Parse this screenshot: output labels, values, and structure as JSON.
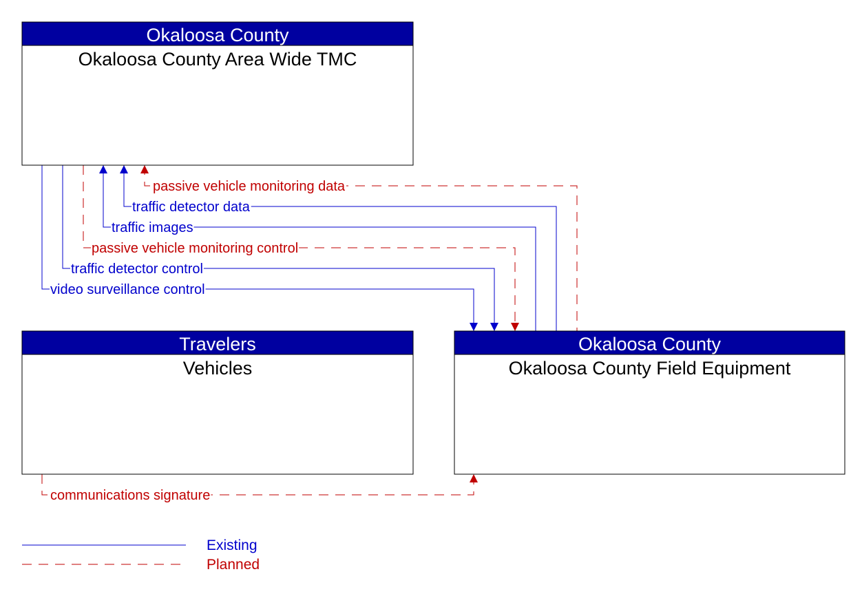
{
  "colors": {
    "header": "#0000A0",
    "existing": "#0000CC",
    "planned": "#C00000",
    "border": "#000000"
  },
  "elements": [
    {
      "id": "tmc",
      "owner": "Okaloosa County",
      "name": "Okaloosa County Area Wide TMC"
    },
    {
      "id": "vehicles",
      "owner": "Travelers",
      "name": "Vehicles"
    },
    {
      "id": "field",
      "owner": "Okaloosa County",
      "name": "Okaloosa County Field Equipment"
    }
  ],
  "flows": [
    {
      "label": "passive vehicle monitoring data",
      "from": "field",
      "to": "tmc",
      "status": "planned"
    },
    {
      "label": "traffic detector data",
      "from": "field",
      "to": "tmc",
      "status": "existing"
    },
    {
      "label": "traffic images",
      "from": "field",
      "to": "tmc",
      "status": "existing"
    },
    {
      "label": "passive vehicle monitoring control",
      "from": "tmc",
      "to": "field",
      "status": "planned"
    },
    {
      "label": "traffic detector control",
      "from": "tmc",
      "to": "field",
      "status": "existing"
    },
    {
      "label": "video surveillance control",
      "from": "tmc",
      "to": "field",
      "status": "existing"
    },
    {
      "label": "communications signature",
      "from": "vehicles",
      "to": "field",
      "status": "planned"
    }
  ],
  "legend": {
    "existing": "Existing",
    "planned": "Planned"
  }
}
